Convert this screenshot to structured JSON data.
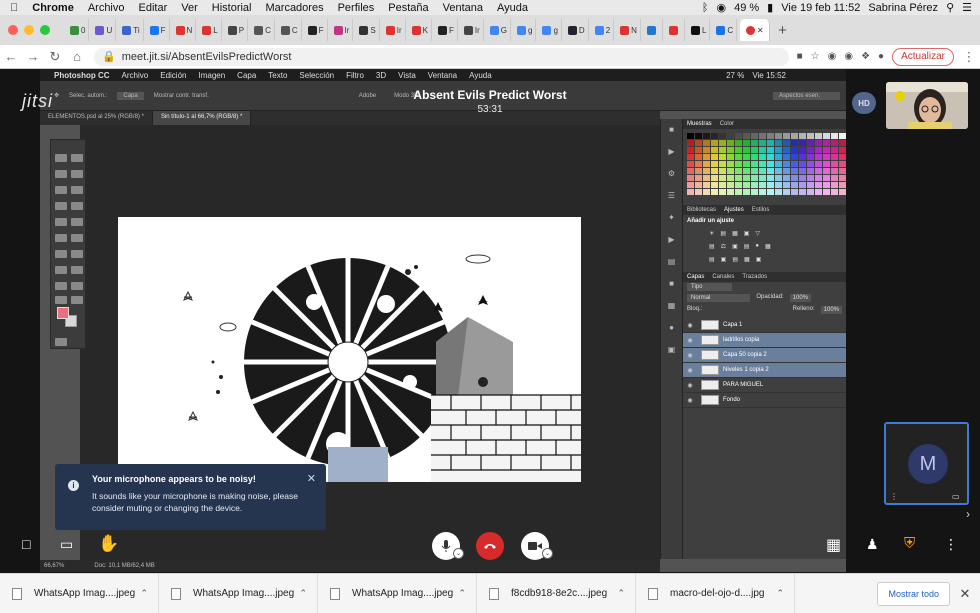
{
  "menubar": {
    "app": "Chrome",
    "items": [
      "Archivo",
      "Editar",
      "Ver",
      "Historial",
      "Marcadores",
      "Perfiles",
      "Pestaña",
      "Ventana",
      "Ayuda"
    ],
    "battery": "49 %",
    "datetime": "Vie 19 feb  11:52",
    "user": "Sabrina Pérez"
  },
  "tabs": [
    {
      "label": "0",
      "color": "#3b8f3b"
    },
    {
      "label": "U",
      "color": "#6a5acd"
    },
    {
      "label": "Ti",
      "color": "#3b66c9"
    },
    {
      "label": "F",
      "color": "#1877f2"
    },
    {
      "label": "N",
      "color": "#d33"
    },
    {
      "label": "L",
      "color": "#d33"
    },
    {
      "label": "P",
      "color": "#444"
    },
    {
      "label": "C",
      "color": "#555"
    },
    {
      "label": "C",
      "color": "#555"
    },
    {
      "label": "F",
      "color": "#222"
    },
    {
      "label": "Ir",
      "color": "#c13584"
    },
    {
      "label": "S",
      "color": "#333"
    },
    {
      "label": "Ir",
      "color": "#d33"
    },
    {
      "label": "K",
      "color": "#d33"
    },
    {
      "label": "F",
      "color": "#222"
    },
    {
      "label": "Ir",
      "color": "#444"
    },
    {
      "label": "G",
      "color": "#4285f4"
    },
    {
      "label": "g",
      "color": "#4285f4"
    },
    {
      "label": "g",
      "color": "#4285f4"
    },
    {
      "label": "D",
      "color": "#223"
    },
    {
      "label": "2",
      "color": "#4285f4"
    },
    {
      "label": "N",
      "color": "#d33"
    },
    {
      "label": "",
      "color": "#27c"
    },
    {
      "label": "",
      "color": "#d33"
    },
    {
      "label": "L",
      "color": "#111"
    },
    {
      "label": "C",
      "color": "#1a73e8"
    }
  ],
  "address": {
    "url": "meet.jit.si/AbsentEvilsPredictWorst",
    "update_label": "Actualizar"
  },
  "photoshop": {
    "app": "Photoshop CC",
    "menu": [
      "Archivo",
      "Edición",
      "Imagen",
      "Capa",
      "Texto",
      "Selección",
      "Filtro",
      "3D",
      "Vista",
      "Ventana",
      "Ayuda"
    ],
    "status_right": "27 %",
    "clock": "Vie 15:52",
    "options": [
      "Selec. autom.:",
      "Capa",
      "Mostrar contr. transf.",
      "Modo 3D:"
    ],
    "workspace": "Aspectos esen.",
    "window_title": "Adobe",
    "doc_tabs": [
      "ELEMENTOS.psd al 25% (RGB/8) *",
      "Sin título-1 al 66,7% (RGB/8) *"
    ],
    "status_zoom": "66,67%",
    "status_doc": "Doc: 10,1 MB/62,4 MB",
    "panel_swatches_tabs": [
      "Muestras",
      "Color"
    ],
    "panel_adjust_tabs": [
      "Bibliotecas",
      "Ajustes",
      "Estilos"
    ],
    "add_adjust_label": "Añadir un ajuste",
    "layers_tabs": [
      "Capas",
      "Canales",
      "Trazados"
    ],
    "layers_filter": "Tipo",
    "blend_mode": "Normal",
    "opacity_label": "Opacidad:",
    "opacity_value": "100%",
    "lock_label": "Bloq.:",
    "fill_label": "Relleno:",
    "fill_value": "100%",
    "layers": [
      {
        "name": "Capa 1",
        "selected": false
      },
      {
        "name": "ladrillos copia",
        "selected": true
      },
      {
        "name": "Capa 50 copia 2",
        "selected": true
      },
      {
        "name": "Niveles 1 copia 2",
        "selected": true
      },
      {
        "name": "PARA MIGUEL",
        "selected": false
      },
      {
        "name": "Fondo",
        "selected": false
      }
    ]
  },
  "jitsi": {
    "logo": "jitsi",
    "meeting_title": "Absent Evils Predict Worst",
    "timer": "53:31",
    "badge": "HD",
    "participant_initial": "M"
  },
  "toast": {
    "title": "Your microphone appears to be noisy!",
    "body": "It sounds like your microphone is making noise, please consider muting or changing the device.",
    "close": "✕"
  },
  "downloads": {
    "items": [
      "WhatsApp Imag....jpeg",
      "WhatsApp Imag....jpeg",
      "WhatsApp Imag....jpeg",
      "f8cdb918-8e2c....jpeg",
      "macro-del-ojo-d....jpg"
    ],
    "show_all": "Mostrar todo"
  },
  "colors": {
    "jitsi_toast": "#253550",
    "hangup": "#d72b2b",
    "ps_selection": "#6a7f9c",
    "foreground": "#e8707c"
  }
}
